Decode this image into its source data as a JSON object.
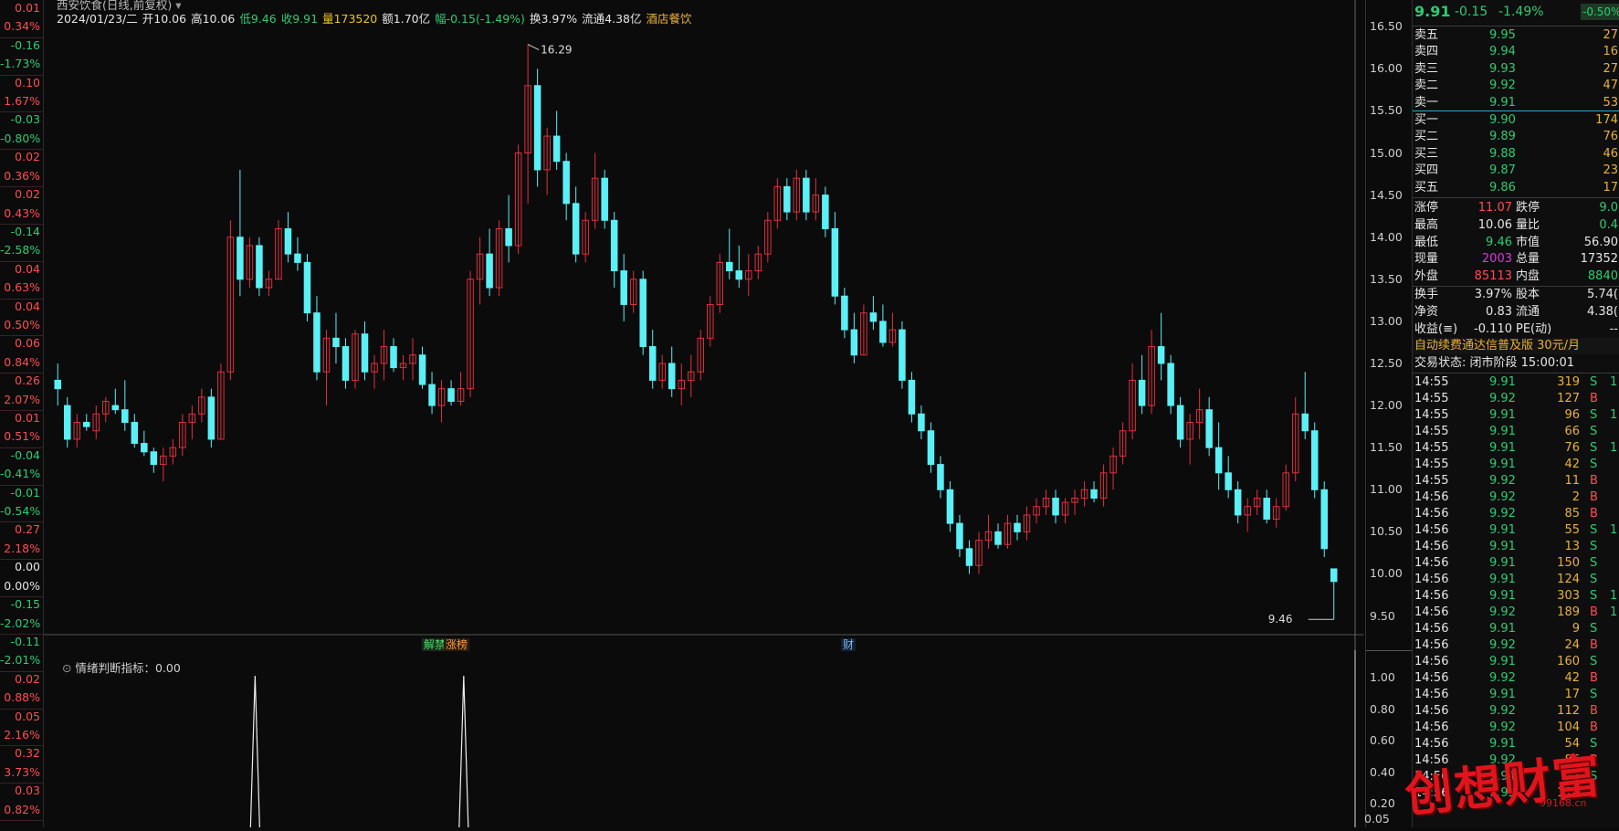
{
  "left_column": [
    {
      "v": "0.01",
      "c": "red"
    },
    {
      "v": "0.34%",
      "c": "red"
    },
    {
      "v": "-0.16",
      "c": "green"
    },
    {
      "v": "-1.73%",
      "c": "green"
    },
    {
      "v": "0.10",
      "c": "red"
    },
    {
      "v": "1.67%",
      "c": "red"
    },
    {
      "v": "-0.03",
      "c": "green"
    },
    {
      "v": "-0.80%",
      "c": "green"
    },
    {
      "v": "0.02",
      "c": "red"
    },
    {
      "v": "0.36%",
      "c": "red"
    },
    {
      "v": "0.02",
      "c": "red"
    },
    {
      "v": "0.43%",
      "c": "red"
    },
    {
      "v": "-0.14",
      "c": "green"
    },
    {
      "v": "-2.58%",
      "c": "green"
    },
    {
      "v": "0.04",
      "c": "red"
    },
    {
      "v": "0.63%",
      "c": "red"
    },
    {
      "v": "0.04",
      "c": "red"
    },
    {
      "v": "0.50%",
      "c": "red"
    },
    {
      "v": "0.06",
      "c": "red"
    },
    {
      "v": "0.84%",
      "c": "red"
    },
    {
      "v": "0.26",
      "c": "red"
    },
    {
      "v": "2.07%",
      "c": "red"
    },
    {
      "v": "0.01",
      "c": "red"
    },
    {
      "v": "0.51%",
      "c": "red"
    },
    {
      "v": "-0.04",
      "c": "green"
    },
    {
      "v": "-0.41%",
      "c": "green"
    },
    {
      "v": "-0.01",
      "c": "green"
    },
    {
      "v": "-0.54%",
      "c": "green"
    },
    {
      "v": "0.27",
      "c": "red"
    },
    {
      "v": "2.18%",
      "c": "red"
    },
    {
      "v": "0.00",
      "c": "white"
    },
    {
      "v": "0.00%",
      "c": "white"
    },
    {
      "v": "-0.15",
      "c": "green"
    },
    {
      "v": "-2.02%",
      "c": "green"
    },
    {
      "v": "-0.11",
      "c": "green"
    },
    {
      "v": "-2.01%",
      "c": "green"
    },
    {
      "v": "0.02",
      "c": "red"
    },
    {
      "v": "0.88%",
      "c": "red"
    },
    {
      "v": "0.05",
      "c": "red"
    },
    {
      "v": "2.16%",
      "c": "red"
    },
    {
      "v": "0.32",
      "c": "red"
    },
    {
      "v": "3.73%",
      "c": "red"
    },
    {
      "v": "0.03",
      "c": "red"
    },
    {
      "v": "0.82%",
      "c": "red"
    }
  ],
  "header": {
    "title": "西安饮食(日线,前复权)",
    "date": "2024/01/23/二",
    "open": "开10.06",
    "high": "高10.06",
    "low": "低9.46",
    "close": "收9.91",
    "volume": "量173520",
    "amount": "额1.70亿",
    "change": "幅-0.15(-1.49%)",
    "turnover": "换3.97%",
    "float": "流通4.38亿",
    "sector": "酒店餐饮"
  },
  "chart_data": {
    "type": "candlestick",
    "title": "西安饮食(日线,前复权)",
    "ylim": [
      9.3,
      16.6
    ],
    "yticks": [
      "16.50",
      "16.00",
      "15.50",
      "15.00",
      "14.50",
      "14.00",
      "13.50",
      "13.00",
      "12.50",
      "12.00",
      "11.50",
      "11.00",
      "10.50",
      "10.00",
      "9.50"
    ],
    "max_label": "16.29",
    "min_label": "9.46",
    "candles": [
      [
        12.3,
        12.5,
        12.0,
        12.2
      ],
      [
        12.0,
        12.1,
        11.5,
        11.6
      ],
      [
        11.6,
        11.9,
        11.5,
        11.8
      ],
      [
        11.8,
        11.9,
        11.7,
        11.75
      ],
      [
        11.7,
        12.0,
        11.6,
        11.9
      ],
      [
        11.9,
        12.1,
        11.8,
        12.05
      ],
      [
        12.0,
        12.2,
        11.9,
        11.95
      ],
      [
        11.95,
        12.3,
        11.7,
        11.8
      ],
      [
        11.8,
        11.9,
        11.5,
        11.55
      ],
      [
        11.55,
        11.7,
        11.4,
        11.45
      ],
      [
        11.45,
        11.5,
        11.2,
        11.3
      ],
      [
        11.3,
        11.5,
        11.1,
        11.4
      ],
      [
        11.4,
        11.6,
        11.3,
        11.5
      ],
      [
        11.5,
        11.9,
        11.4,
        11.8
      ],
      [
        11.8,
        12.0,
        11.6,
        11.9
      ],
      [
        11.9,
        12.2,
        11.8,
        12.1
      ],
      [
        12.1,
        12.2,
        11.5,
        11.6
      ],
      [
        11.6,
        12.5,
        11.6,
        12.4
      ],
      [
        12.4,
        14.2,
        12.3,
        14.0
      ],
      [
        14.0,
        14.8,
        13.3,
        13.5
      ],
      [
        13.5,
        14.0,
        13.4,
        13.9
      ],
      [
        13.9,
        14.0,
        13.3,
        13.4
      ],
      [
        13.4,
        13.6,
        13.3,
        13.5
      ],
      [
        13.5,
        14.2,
        13.5,
        14.1
      ],
      [
        14.1,
        14.3,
        13.7,
        13.8
      ],
      [
        13.8,
        14.0,
        13.6,
        13.7
      ],
      [
        13.7,
        13.8,
        13.0,
        13.1
      ],
      [
        13.1,
        13.3,
        12.3,
        12.4
      ],
      [
        12.4,
        12.9,
        12.0,
        12.8
      ],
      [
        12.8,
        13.1,
        12.5,
        12.7
      ],
      [
        12.7,
        12.8,
        12.2,
        12.3
      ],
      [
        12.3,
        12.9,
        12.2,
        12.85
      ],
      [
        12.85,
        13.0,
        12.3,
        12.4
      ],
      [
        12.4,
        12.6,
        12.2,
        12.5
      ],
      [
        12.5,
        12.9,
        12.3,
        12.7
      ],
      [
        12.7,
        12.8,
        12.4,
        12.45
      ],
      [
        12.45,
        12.6,
        12.3,
        12.5
      ],
      [
        12.5,
        12.8,
        12.3,
        12.6
      ],
      [
        12.6,
        12.7,
        12.2,
        12.25
      ],
      [
        12.25,
        12.4,
        11.9,
        12.0
      ],
      [
        12.0,
        12.3,
        11.8,
        12.2
      ],
      [
        12.2,
        12.3,
        12.0,
        12.05
      ],
      [
        12.05,
        12.4,
        12.0,
        12.2
      ],
      [
        12.2,
        13.6,
        12.1,
        13.5
      ],
      [
        13.5,
        14.0,
        13.2,
        13.8
      ],
      [
        13.8,
        14.1,
        13.3,
        13.4
      ],
      [
        13.4,
        14.2,
        13.3,
        14.1
      ],
      [
        14.1,
        14.5,
        13.7,
        13.9
      ],
      [
        13.9,
        15.1,
        13.8,
        15.0
      ],
      [
        15.0,
        16.29,
        14.4,
        15.8
      ],
      [
        15.8,
        16.0,
        14.6,
        14.8
      ],
      [
        14.8,
        15.3,
        14.5,
        15.2
      ],
      [
        15.2,
        15.5,
        14.8,
        14.9
      ],
      [
        14.9,
        15.0,
        14.2,
        14.4
      ],
      [
        14.4,
        14.6,
        13.7,
        13.8
      ],
      [
        13.8,
        14.3,
        13.7,
        14.2
      ],
      [
        14.2,
        15.0,
        14.1,
        14.7
      ],
      [
        14.7,
        14.8,
        14.1,
        14.2
      ],
      [
        14.2,
        14.3,
        13.4,
        13.6
      ],
      [
        13.6,
        13.8,
        13.0,
        13.2
      ],
      [
        13.2,
        13.6,
        13.1,
        13.5
      ],
      [
        13.5,
        13.6,
        12.6,
        12.7
      ],
      [
        12.7,
        12.9,
        12.2,
        12.3
      ],
      [
        12.3,
        12.6,
        12.2,
        12.5
      ],
      [
        12.5,
        12.7,
        12.1,
        12.2
      ],
      [
        12.2,
        12.5,
        12.0,
        12.3
      ],
      [
        12.3,
        12.6,
        12.1,
        12.4
      ],
      [
        12.4,
        12.9,
        12.3,
        12.8
      ],
      [
        12.8,
        13.3,
        12.7,
        13.2
      ],
      [
        13.2,
        13.8,
        13.1,
        13.7
      ],
      [
        13.7,
        14.1,
        13.5,
        13.6
      ],
      [
        13.6,
        13.9,
        13.4,
        13.5
      ],
      [
        13.5,
        13.8,
        13.3,
        13.6
      ],
      [
        13.6,
        13.9,
        13.5,
        13.8
      ],
      [
        13.8,
        14.3,
        13.7,
        14.2
      ],
      [
        14.2,
        14.7,
        14.1,
        14.6
      ],
      [
        14.6,
        14.7,
        14.2,
        14.3
      ],
      [
        14.3,
        14.8,
        14.2,
        14.7
      ],
      [
        14.7,
        14.8,
        14.2,
        14.3
      ],
      [
        14.3,
        14.7,
        14.2,
        14.5
      ],
      [
        14.5,
        14.6,
        14.0,
        14.1
      ],
      [
        14.1,
        14.3,
        13.2,
        13.3
      ],
      [
        13.3,
        13.4,
        12.8,
        12.9
      ],
      [
        12.9,
        13.1,
        12.5,
        12.6
      ],
      [
        12.6,
        13.2,
        12.6,
        13.1
      ],
      [
        13.1,
        13.3,
        12.9,
        13.0
      ],
      [
        13.0,
        13.2,
        12.7,
        12.75
      ],
      [
        12.75,
        13.1,
        12.7,
        12.9
      ],
      [
        12.9,
        13.0,
        12.2,
        12.3
      ],
      [
        12.3,
        12.4,
        11.8,
        11.9
      ],
      [
        11.9,
        12.0,
        11.6,
        11.7
      ],
      [
        11.7,
        11.8,
        11.2,
        11.3
      ],
      [
        11.3,
        11.4,
        10.9,
        11.0
      ],
      [
        11.0,
        11.1,
        10.5,
        10.6
      ],
      [
        10.6,
        10.7,
        10.2,
        10.3
      ],
      [
        10.3,
        10.4,
        10.0,
        10.1
      ],
      [
        10.1,
        10.5,
        10.0,
        10.4
      ],
      [
        10.4,
        10.7,
        10.3,
        10.5
      ],
      [
        10.5,
        10.6,
        10.3,
        10.35
      ],
      [
        10.35,
        10.7,
        10.3,
        10.6
      ],
      [
        10.6,
        10.7,
        10.4,
        10.5
      ],
      [
        10.5,
        10.8,
        10.4,
        10.7
      ],
      [
        10.7,
        10.9,
        10.6,
        10.8
      ],
      [
        10.8,
        11.0,
        10.7,
        10.9
      ],
      [
        10.9,
        11.0,
        10.6,
        10.7
      ],
      [
        10.7,
        10.9,
        10.6,
        10.85
      ],
      [
        10.85,
        11.0,
        10.7,
        10.9
      ],
      [
        10.9,
        11.1,
        10.8,
        11.0
      ],
      [
        11.0,
        11.1,
        10.85,
        10.9
      ],
      [
        10.9,
        11.3,
        10.8,
        11.2
      ],
      [
        11.2,
        11.5,
        11.0,
        11.4
      ],
      [
        11.4,
        11.8,
        11.3,
        11.7
      ],
      [
        11.7,
        12.5,
        11.6,
        12.3
      ],
      [
        12.3,
        12.6,
        11.9,
        12.0
      ],
      [
        12.0,
        12.9,
        11.9,
        12.7
      ],
      [
        12.7,
        13.1,
        12.3,
        12.5
      ],
      [
        12.5,
        12.6,
        11.9,
        12.0
      ],
      [
        12.0,
        12.1,
        11.5,
        11.6
      ],
      [
        11.6,
        11.9,
        11.3,
        11.8
      ],
      [
        11.8,
        12.2,
        11.6,
        11.95
      ],
      [
        11.95,
        12.1,
        11.4,
        11.5
      ],
      [
        11.5,
        11.8,
        11.0,
        11.2
      ],
      [
        11.2,
        11.4,
        10.9,
        11.0
      ],
      [
        11.0,
        11.1,
        10.6,
        10.7
      ],
      [
        10.7,
        10.9,
        10.5,
        10.8
      ],
      [
        10.8,
        11.0,
        10.7,
        10.9
      ],
      [
        10.9,
        11.0,
        10.6,
        10.65
      ],
      [
        10.65,
        10.9,
        10.55,
        10.8
      ],
      [
        10.8,
        11.3,
        10.75,
        11.2
      ],
      [
        11.2,
        12.1,
        11.1,
        11.9
      ],
      [
        11.9,
        12.4,
        11.6,
        11.7
      ],
      [
        11.7,
        11.8,
        10.9,
        11.0
      ],
      [
        11.0,
        11.1,
        10.2,
        10.3
      ],
      [
        10.06,
        10.06,
        9.46,
        9.91
      ]
    ]
  },
  "flags": {
    "left": "解禁",
    "mid": "涨榜",
    "earnings": "财"
  },
  "sub_chart": {
    "title": "情绪判断指标：0.00",
    "yticks": [
      "1.00",
      "0.80",
      "0.60",
      "0.40",
      "0.20"
    ],
    "bottom_label": "0.05",
    "spikes_at": [
      0.155,
      0.315
    ]
  },
  "quote": {
    "price": "9.91",
    "change": "-0.15",
    "pct": "-1.49%",
    "tag": "-0.50%",
    "asks": [
      {
        "label": "卖五",
        "price": "9.95",
        "vol": "27"
      },
      {
        "label": "卖四",
        "price": "9.94",
        "vol": "16"
      },
      {
        "label": "卖三",
        "price": "9.93",
        "vol": "27"
      },
      {
        "label": "卖二",
        "price": "9.92",
        "vol": "47"
      },
      {
        "label": "卖一",
        "price": "9.91",
        "vol": "53"
      }
    ],
    "bids": [
      {
        "label": "买一",
        "price": "9.90",
        "vol": "174"
      },
      {
        "label": "买二",
        "price": "9.89",
        "vol": "76"
      },
      {
        "label": "买三",
        "price": "9.88",
        "vol": "46"
      },
      {
        "label": "买四",
        "price": "9.87",
        "vol": "23"
      },
      {
        "label": "买五",
        "price": "9.86",
        "vol": "17"
      }
    ],
    "stats": [
      {
        "k1": "涨停",
        "v1": "11.07",
        "c1": "red",
        "k2": "跌停",
        "v2": "9.0",
        "c2": "green"
      },
      {
        "k1": "最高",
        "v1": "10.06",
        "c1": "white",
        "k2": "量比",
        "v2": "0.4",
        "c2": "green"
      },
      {
        "k1": "最低",
        "v1": "9.46",
        "c1": "green",
        "k2": "市值",
        "v2": "56.90",
        "c2": "white"
      },
      {
        "k1": "现量",
        "v1": "2003",
        "c1": "magenta",
        "k2": "总量",
        "v2": "17352",
        "c2": "white"
      },
      {
        "k1": "外盘",
        "v1": "85113",
        "c1": "red",
        "k2": "内盘",
        "v2": "8840",
        "c2": "green"
      }
    ],
    "stats2": [
      {
        "k1": "换手",
        "v1": "3.97%",
        "k2": "股本",
        "v2": "5.74("
      },
      {
        "k1": "净资",
        "v1": "0.83",
        "k2": "流通",
        "v2": "4.38("
      },
      {
        "k1": "收益(≡)",
        "v1": "-0.110",
        "k2": "PE(动)",
        "v2": "--"
      }
    ],
    "promo": "自动续费通达信普及版  30元/月",
    "status": "交易状态: 闭市阶段 15:00:01"
  },
  "ticks": [
    {
      "t": "14:55",
      "p": "9.91",
      "pc": "green",
      "v": "319",
      "vc": "gold",
      "s": "S",
      "x": "1"
    },
    {
      "t": "14:55",
      "p": "9.92",
      "pc": "green",
      "v": "127",
      "vc": "gold",
      "s": "B",
      "x": ""
    },
    {
      "t": "14:55",
      "p": "9.91",
      "pc": "green",
      "v": "96",
      "vc": "gold",
      "s": "S",
      "x": "1"
    },
    {
      "t": "14:55",
      "p": "9.91",
      "pc": "green",
      "v": "66",
      "vc": "gold",
      "s": "S",
      "x": ""
    },
    {
      "t": "14:55",
      "p": "9.91",
      "pc": "green",
      "v": "76",
      "vc": "gold",
      "s": "S",
      "x": "1"
    },
    {
      "t": "14:55",
      "p": "9.91",
      "pc": "green",
      "v": "42",
      "vc": "gold",
      "s": "S",
      "x": ""
    },
    {
      "t": "14:55",
      "p": "9.92",
      "pc": "green",
      "v": "11",
      "vc": "gold",
      "s": "B",
      "x": ""
    },
    {
      "t": "14:56",
      "p": "9.92",
      "pc": "green",
      "v": "2",
      "vc": "gold",
      "s": "B",
      "x": ""
    },
    {
      "t": "14:56",
      "p": "9.92",
      "pc": "green",
      "v": "85",
      "vc": "gold",
      "s": "B",
      "x": ""
    },
    {
      "t": "14:56",
      "p": "9.91",
      "pc": "green",
      "v": "55",
      "vc": "gold",
      "s": "S",
      "x": "1"
    },
    {
      "t": "14:56",
      "p": "9.91",
      "pc": "green",
      "v": "13",
      "vc": "gold",
      "s": "S",
      "x": ""
    },
    {
      "t": "14:56",
      "p": "9.91",
      "pc": "green",
      "v": "150",
      "vc": "gold",
      "s": "S",
      "x": ""
    },
    {
      "t": "14:56",
      "p": "9.91",
      "pc": "green",
      "v": "124",
      "vc": "gold",
      "s": "S",
      "x": ""
    },
    {
      "t": "14:56",
      "p": "9.91",
      "pc": "green",
      "v": "303",
      "vc": "gold",
      "s": "S",
      "x": "1"
    },
    {
      "t": "14:56",
      "p": "9.92",
      "pc": "green",
      "v": "189",
      "vc": "gold",
      "s": "B",
      "x": "1"
    },
    {
      "t": "14:56",
      "p": "9.91",
      "pc": "green",
      "v": "9",
      "vc": "gold",
      "s": "S",
      "x": ""
    },
    {
      "t": "14:56",
      "p": "9.92",
      "pc": "green",
      "v": "24",
      "vc": "gold",
      "s": "B",
      "x": ""
    },
    {
      "t": "14:56",
      "p": "9.91",
      "pc": "green",
      "v": "160",
      "vc": "gold",
      "s": "S",
      "x": ""
    },
    {
      "t": "14:56",
      "p": "9.92",
      "pc": "green",
      "v": "42",
      "vc": "gold",
      "s": "B",
      "x": ""
    },
    {
      "t": "14:56",
      "p": "9.91",
      "pc": "green",
      "v": "17",
      "vc": "gold",
      "s": "S",
      "x": ""
    },
    {
      "t": "14:56",
      "p": "9.92",
      "pc": "green",
      "v": "112",
      "vc": "gold",
      "s": "B",
      "x": ""
    },
    {
      "t": "14:56",
      "p": "9.92",
      "pc": "green",
      "v": "104",
      "vc": "gold",
      "s": "B",
      "x": ""
    },
    {
      "t": "14:56",
      "p": "9.91",
      "pc": "green",
      "v": "54",
      "vc": "gold",
      "s": "S",
      "x": ""
    },
    {
      "t": "14:56",
      "p": "9.92",
      "pc": "green",
      "v": "86",
      "vc": "gold",
      "s": "B",
      "x": ""
    },
    {
      "t": "14:56",
      "p": "9.91",
      "pc": "green",
      "v": "87",
      "vc": "gold",
      "s": "S",
      "x": ""
    },
    {
      "t": "14:56",
      "p": "9.92",
      "pc": "green",
      "v": "116",
      "vc": "gold",
      "s": "B",
      "x": ""
    }
  ],
  "watermark": {
    "text": "创想财富",
    "url": "99168.cn"
  },
  "colors": {
    "up": "#e0313b",
    "down": "#5af0f6",
    "bg": "#0b0b0c",
    "grid": "#2a2a2a"
  }
}
